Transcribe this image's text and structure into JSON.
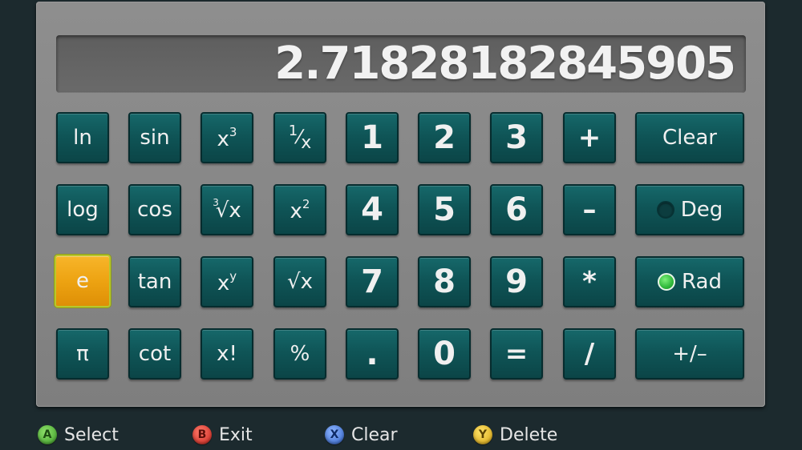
{
  "display": {
    "value": "2.71828182845905"
  },
  "keys": {
    "ln": "ln",
    "sin": "sin",
    "x": "x",
    "cube_exp": "3",
    "inv_num": "1",
    "inv_den": "x",
    "d1": "1",
    "d2": "2",
    "d3": "3",
    "plus": "+",
    "clear": "Clear",
    "log": "log",
    "cos": "cos",
    "cbrt_index": "3",
    "cbrt": "√x",
    "sq_exp": "2",
    "d4": "4",
    "d5": "5",
    "d6": "6",
    "minus": "–",
    "deg": "Deg",
    "e": "e",
    "tan": "tan",
    "pow_exp": "y",
    "sqrt": "√x",
    "d7": "7",
    "d8": "8",
    "d9": "9",
    "mul": "*",
    "rad": "Rad",
    "pi": "π",
    "cot": "cot",
    "fact": "x!",
    "percent": "%",
    "dot": ".",
    "d0": "0",
    "eq": "=",
    "div": "/",
    "negate": "+/–"
  },
  "angle_mode": {
    "selected": "Rad"
  },
  "selected_key": "e",
  "hints": [
    {
      "button": "A",
      "label": "Select"
    },
    {
      "button": "B",
      "label": "Exit"
    },
    {
      "button": "X",
      "label": "Clear"
    },
    {
      "button": "Y",
      "label": "Delete"
    }
  ],
  "colors": {
    "key": "#0f5557",
    "key_selected": "#eda312",
    "panel": "#868686",
    "background": "#1c2a2e",
    "radio_on": "#2fb83a"
  }
}
